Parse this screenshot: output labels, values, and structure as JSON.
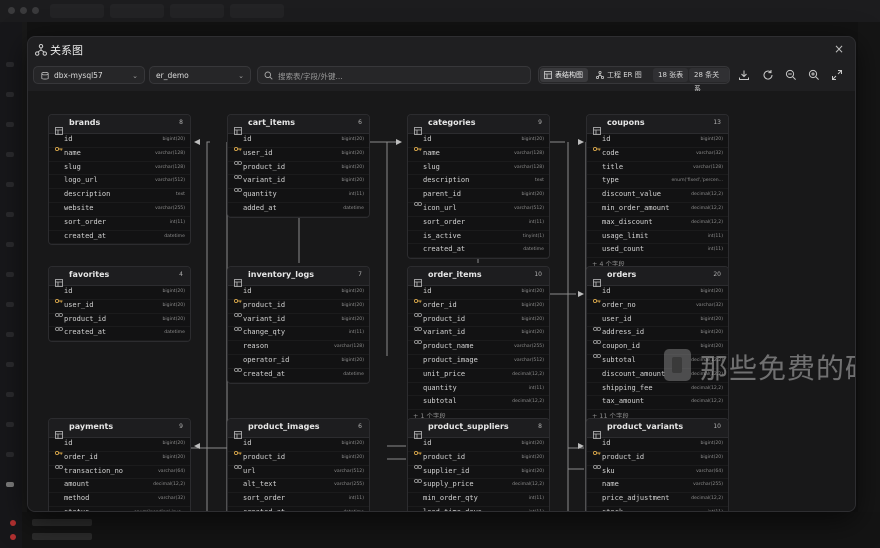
{
  "modal": {
    "title": "关系图",
    "close_label": "×"
  },
  "toolbar": {
    "connection": "dbx-mysql57",
    "database": "er_demo",
    "search_placeholder": "搜索表/字段/外键...",
    "view_table": "表结构图",
    "view_er": "工程 ER 图",
    "table_count": "18 张表",
    "relation_count": "28 条关系"
  },
  "watermark": "那些免费的砖",
  "tables": [
    {
      "name": "brands",
      "count": "8",
      "columns": [
        {
          "n": "id",
          "t": "bigint(20)",
          "k": "pk"
        },
        {
          "n": "name",
          "t": "varchar(128)",
          "k": ""
        },
        {
          "n": "slug",
          "t": "varchar(128)",
          "k": ""
        },
        {
          "n": "logo_url",
          "t": "varchar(512)",
          "k": ""
        },
        {
          "n": "description",
          "t": "text",
          "k": ""
        },
        {
          "n": "website",
          "t": "varchar(255)",
          "k": ""
        },
        {
          "n": "sort_order",
          "t": "int(11)",
          "k": ""
        },
        {
          "n": "created_at",
          "t": "datetime",
          "k": ""
        }
      ],
      "more": ""
    },
    {
      "name": "cart_items",
      "count": "6",
      "columns": [
        {
          "n": "id",
          "t": "bigint(20)",
          "k": "pk"
        },
        {
          "n": "user_id",
          "t": "bigint(20)",
          "k": "fk"
        },
        {
          "n": "product_id",
          "t": "bigint(20)",
          "k": "fk"
        },
        {
          "n": "variant_id",
          "t": "bigint(20)",
          "k": "fk"
        },
        {
          "n": "quantity",
          "t": "int(11)",
          "k": ""
        },
        {
          "n": "added_at",
          "t": "datetime",
          "k": ""
        }
      ],
      "more": ""
    },
    {
      "name": "categories",
      "count": "9",
      "columns": [
        {
          "n": "id",
          "t": "bigint(20)",
          "k": "pk"
        },
        {
          "n": "name",
          "t": "varchar(128)",
          "k": ""
        },
        {
          "n": "slug",
          "t": "varchar(128)",
          "k": ""
        },
        {
          "n": "description",
          "t": "text",
          "k": ""
        },
        {
          "n": "parent_id",
          "t": "bigint(20)",
          "k": "fk"
        },
        {
          "n": "icon_url",
          "t": "varchar(512)",
          "k": ""
        },
        {
          "n": "sort_order",
          "t": "int(11)",
          "k": ""
        },
        {
          "n": "is_active",
          "t": "tinyint(1)",
          "k": ""
        },
        {
          "n": "created_at",
          "t": "datetime",
          "k": ""
        }
      ],
      "more": ""
    },
    {
      "name": "coupons",
      "count": "13",
      "columns": [
        {
          "n": "id",
          "t": "bigint(20)",
          "k": "pk"
        },
        {
          "n": "code",
          "t": "varchar(32)",
          "k": ""
        },
        {
          "n": "title",
          "t": "varchar(128)",
          "k": ""
        },
        {
          "n": "type",
          "t": "enum('fixed','percen...",
          "k": ""
        },
        {
          "n": "discount_value",
          "t": "decimal(12,2)",
          "k": ""
        },
        {
          "n": "min_order_amount",
          "t": "decimal(12,2)",
          "k": ""
        },
        {
          "n": "max_discount",
          "t": "decimal(12,2)",
          "k": ""
        },
        {
          "n": "usage_limit",
          "t": "int(11)",
          "k": ""
        },
        {
          "n": "used_count",
          "t": "int(11)",
          "k": ""
        }
      ],
      "more": "+ 4 个字段"
    },
    {
      "name": "favorites",
      "count": "4",
      "columns": [
        {
          "n": "id",
          "t": "bigint(20)",
          "k": "pk"
        },
        {
          "n": "user_id",
          "t": "bigint(20)",
          "k": "fk"
        },
        {
          "n": "product_id",
          "t": "bigint(20)",
          "k": "fk"
        },
        {
          "n": "created_at",
          "t": "datetime",
          "k": ""
        }
      ],
      "more": ""
    },
    {
      "name": "inventory_logs",
      "count": "7",
      "columns": [
        {
          "n": "id",
          "t": "bigint(20)",
          "k": "pk"
        },
        {
          "n": "product_id",
          "t": "bigint(20)",
          "k": "fk"
        },
        {
          "n": "variant_id",
          "t": "bigint(20)",
          "k": "fk"
        },
        {
          "n": "change_qty",
          "t": "int(11)",
          "k": ""
        },
        {
          "n": "reason",
          "t": "varchar(128)",
          "k": ""
        },
        {
          "n": "operator_id",
          "t": "bigint(20)",
          "k": "fk"
        },
        {
          "n": "created_at",
          "t": "datetime",
          "k": ""
        }
      ],
      "more": ""
    },
    {
      "name": "order_items",
      "count": "10",
      "columns": [
        {
          "n": "id",
          "t": "bigint(20)",
          "k": "pk"
        },
        {
          "n": "order_id",
          "t": "bigint(20)",
          "k": "fk"
        },
        {
          "n": "product_id",
          "t": "bigint(20)",
          "k": "fk"
        },
        {
          "n": "variant_id",
          "t": "bigint(20)",
          "k": "fk"
        },
        {
          "n": "product_name",
          "t": "varchar(255)",
          "k": ""
        },
        {
          "n": "product_image",
          "t": "varchar(512)",
          "k": ""
        },
        {
          "n": "unit_price",
          "t": "decimal(12,2)",
          "k": ""
        },
        {
          "n": "quantity",
          "t": "int(11)",
          "k": ""
        },
        {
          "n": "subtotal",
          "t": "decimal(12,2)",
          "k": ""
        }
      ],
      "more": "+ 1 个字段"
    },
    {
      "name": "orders",
      "count": "20",
      "columns": [
        {
          "n": "id",
          "t": "bigint(20)",
          "k": "pk"
        },
        {
          "n": "order_no",
          "t": "varchar(32)",
          "k": ""
        },
        {
          "n": "user_id",
          "t": "bigint(20)",
          "k": "fk"
        },
        {
          "n": "address_id",
          "t": "bigint(20)",
          "k": "fk"
        },
        {
          "n": "coupon_id",
          "t": "bigint(20)",
          "k": "fk"
        },
        {
          "n": "subtotal",
          "t": "decimal(12,2)",
          "k": ""
        },
        {
          "n": "discount_amount",
          "t": "decimal(12,2)",
          "k": ""
        },
        {
          "n": "shipping_fee",
          "t": "decimal(12,2)",
          "k": ""
        },
        {
          "n": "tax_amount",
          "t": "decimal(12,2)",
          "k": ""
        }
      ],
      "more": "+ 11 个字段"
    },
    {
      "name": "payments",
      "count": "9",
      "columns": [
        {
          "n": "id",
          "t": "bigint(20)",
          "k": "pk"
        },
        {
          "n": "order_id",
          "t": "bigint(20)",
          "k": "fk"
        },
        {
          "n": "transaction_no",
          "t": "varchar(64)",
          "k": ""
        },
        {
          "n": "amount",
          "t": "decimal(12,2)",
          "k": ""
        },
        {
          "n": "method",
          "t": "varchar(32)",
          "k": ""
        },
        {
          "n": "status",
          "t": "enum('pending','suc...",
          "k": ""
        }
      ],
      "more": ""
    },
    {
      "name": "product_images",
      "count": "6",
      "columns": [
        {
          "n": "id",
          "t": "bigint(20)",
          "k": "pk"
        },
        {
          "n": "product_id",
          "t": "bigint(20)",
          "k": "fk"
        },
        {
          "n": "url",
          "t": "varchar(512)",
          "k": ""
        },
        {
          "n": "alt_text",
          "t": "varchar(255)",
          "k": ""
        },
        {
          "n": "sort_order",
          "t": "int(11)",
          "k": ""
        },
        {
          "n": "created_at",
          "t": "datetime",
          "k": ""
        }
      ],
      "more": ""
    },
    {
      "name": "product_suppliers",
      "count": "8",
      "columns": [
        {
          "n": "id",
          "t": "bigint(20)",
          "k": "pk"
        },
        {
          "n": "product_id",
          "t": "bigint(20)",
          "k": "fk"
        },
        {
          "n": "supplier_id",
          "t": "bigint(20)",
          "k": "fk"
        },
        {
          "n": "supply_price",
          "t": "decimal(12,2)",
          "k": ""
        },
        {
          "n": "min_order_qty",
          "t": "int(11)",
          "k": ""
        },
        {
          "n": "lead_time_days",
          "t": "int(11)",
          "k": ""
        }
      ],
      "more": ""
    },
    {
      "name": "product_variants",
      "count": "10",
      "columns": [
        {
          "n": "id",
          "t": "bigint(20)",
          "k": "pk"
        },
        {
          "n": "product_id",
          "t": "bigint(20)",
          "k": "fk"
        },
        {
          "n": "sku",
          "t": "varchar(64)",
          "k": ""
        },
        {
          "n": "name",
          "t": "varchar(255)",
          "k": ""
        },
        {
          "n": "price_adjustment",
          "t": "decimal(12,2)",
          "k": ""
        },
        {
          "n": "stock",
          "t": "int(11)",
          "k": ""
        }
      ],
      "more": ""
    }
  ]
}
